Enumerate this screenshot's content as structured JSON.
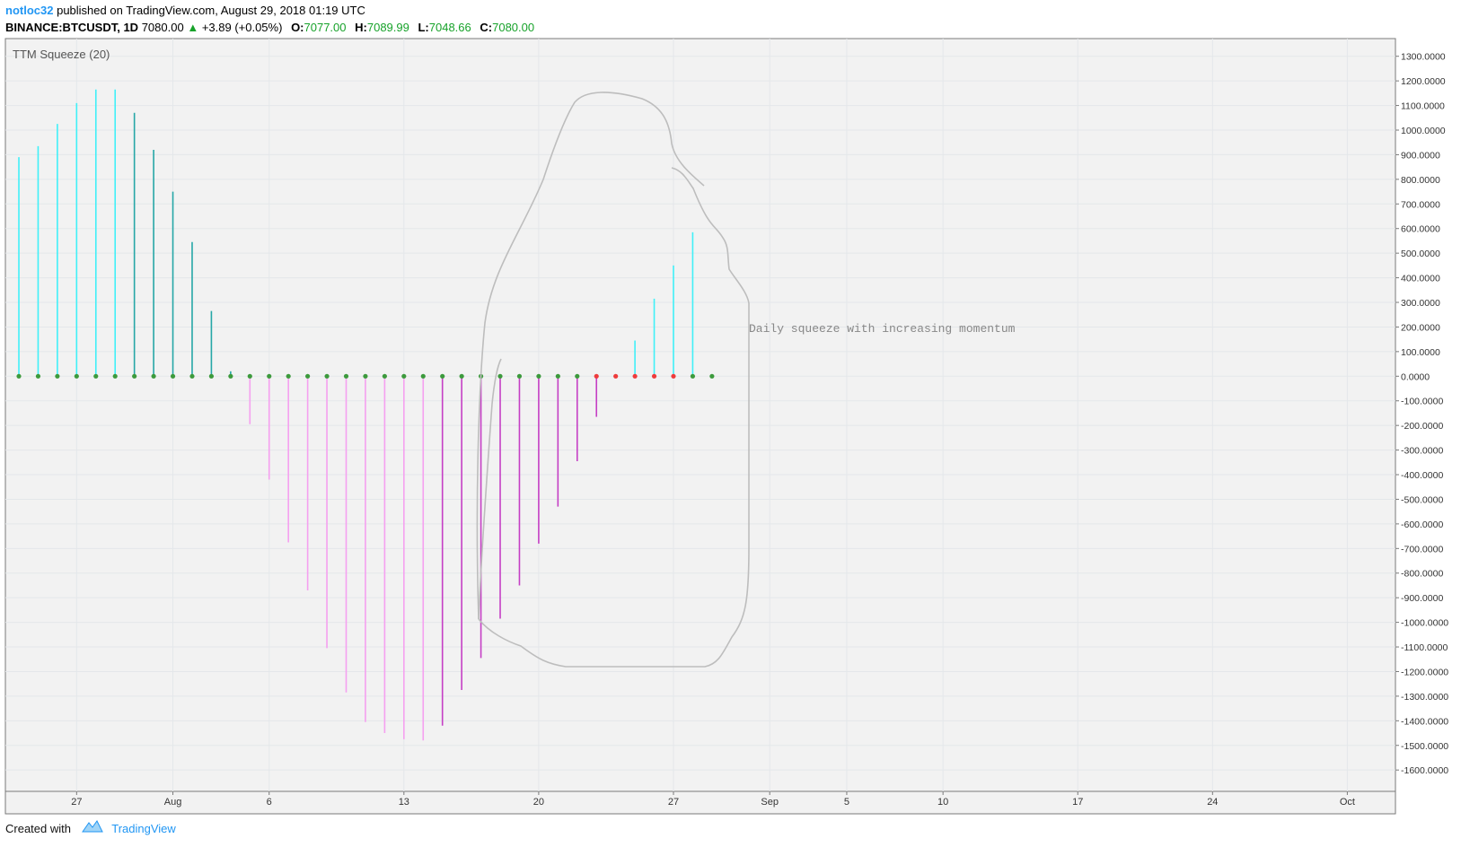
{
  "header": {
    "author": "notloc32",
    "published": "published on TradingView.com, August 29, 2018 01:19 UTC",
    "symbol": "BINANCE:BTCUSDT, 1D",
    "last": "7080.00",
    "change": "+3.89 (+0.05%)",
    "o_label": "O:",
    "o_value": "7077.00",
    "h_label": "H:",
    "h_value": "7089.99",
    "l_label": "L:",
    "l_value": "7048.66",
    "c_label": "C:",
    "c_value": "7080.00"
  },
  "footer": {
    "created_with": "Created with",
    "brand": "TradingView"
  },
  "colors": {
    "up_rising": "#40f0f8",
    "up_falling": "#26a7a7",
    "down_falling": "#f5a0f0",
    "down_rising": "#c53fc5",
    "squeeze_off": "#3c9a3c",
    "squeeze_on": "#ee3b3b",
    "drawing": "#bdbdbd",
    "background": "#f2f2f2"
  },
  "chart_data": {
    "type": "histogram",
    "title": "TTM Squeeze (20)",
    "annotation": "Daily squeeze with increasing momentum",
    "ylim": [
      -1650,
      1350
    ],
    "y_ticks": [
      1300,
      1200,
      1100,
      1000,
      900,
      800,
      700,
      600,
      500,
      400,
      300,
      200,
      100,
      0,
      -100,
      -200,
      -300,
      -400,
      -500,
      -600,
      -700,
      -800,
      -900,
      -1000,
      -1100,
      -1200,
      -1300,
      -1400,
      -1500,
      -1600
    ],
    "y_tick_labels": [
      "1300.0000",
      "1200.0000",
      "1100.0000",
      "1000.0000",
      "900.0000",
      "800.0000",
      "700.0000",
      "600.0000",
      "500.0000",
      "400.0000",
      "300.0000",
      "200.0000",
      "100.0000",
      "0.0000",
      "-100.0000",
      "-200.0000",
      "-300.0000",
      "-400.0000",
      "-500.0000",
      "-600.0000",
      "-700.0000",
      "-800.0000",
      "-900.0000",
      "-1000.0000",
      "-1100.0000",
      "-1200.0000",
      "-1300.0000",
      "-1400.0000",
      "-1500.0000",
      "-1600.0000"
    ],
    "x_start_date": "2018-07-24",
    "x_range_days": [
      -0.7,
      71.5
    ],
    "x_ticks": [
      {
        "day": 3,
        "label": "27"
      },
      {
        "day": 8,
        "label": "Aug"
      },
      {
        "day": 13,
        "label": "6"
      },
      {
        "day": 20,
        "label": "13"
      },
      {
        "day": 27,
        "label": "20"
      },
      {
        "day": 34,
        "label": "27"
      },
      {
        "day": 39,
        "label": "Sep"
      },
      {
        "day": 43,
        "label": "5"
      },
      {
        "day": 48,
        "label": "10"
      },
      {
        "day": 55,
        "label": "17"
      },
      {
        "day": 62,
        "label": "24"
      },
      {
        "day": 69,
        "label": "Oct"
      }
    ],
    "dates": [
      "Jul 24",
      "Jul 25",
      "Jul 26",
      "Jul 27",
      "Jul 28",
      "Jul 29",
      "Jul 30",
      "Jul 31",
      "Aug 1",
      "Aug 2",
      "Aug 3",
      "Aug 4",
      "Aug 5",
      "Aug 6",
      "Aug 7",
      "Aug 8",
      "Aug 9",
      "Aug 10",
      "Aug 11",
      "Aug 12",
      "Aug 13",
      "Aug 14",
      "Aug 15",
      "Aug 16",
      "Aug 17",
      "Aug 18",
      "Aug 19",
      "Aug 20",
      "Aug 21",
      "Aug 22",
      "Aug 23",
      "Aug 24",
      "Aug 25",
      "Aug 26",
      "Aug 27",
      "Aug 28",
      "Aug 29"
    ],
    "momentum": [
      890,
      935,
      1025,
      1110,
      1165,
      1165,
      1070,
      920,
      750,
      545,
      265,
      20,
      -195,
      -420,
      -675,
      -870,
      -1105,
      -1285,
      -1405,
      -1450,
      -1475,
      -1480,
      -1420,
      -1275,
      -1145,
      -985,
      -850,
      -680,
      -530,
      -345,
      -165,
      0,
      145,
      315,
      450,
      585,
      0
    ],
    "squeeze_on": [
      false,
      false,
      false,
      false,
      false,
      false,
      false,
      false,
      false,
      false,
      false,
      false,
      false,
      false,
      false,
      false,
      false,
      false,
      false,
      false,
      false,
      false,
      false,
      false,
      false,
      false,
      false,
      false,
      false,
      false,
      true,
      true,
      true,
      true,
      true,
      false,
      false
    ]
  }
}
